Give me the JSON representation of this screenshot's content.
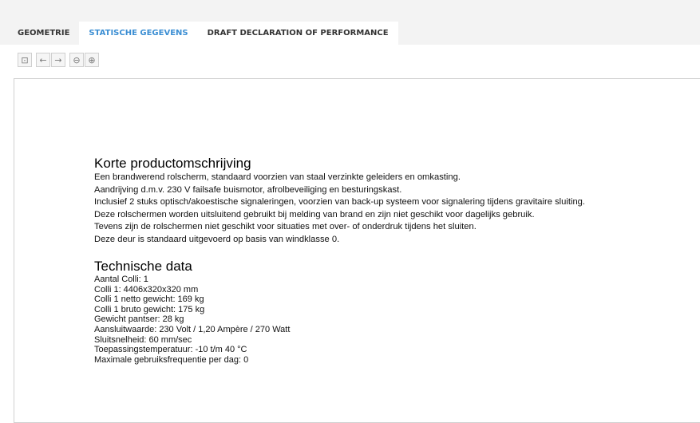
{
  "tabs": [
    {
      "label": "GEOMETRIE"
    },
    {
      "label": "STATISCHE GEGEVENS"
    },
    {
      "label": "DRAFT DECLARATION OF PERFORMANCE"
    }
  ],
  "toolbar": {
    "buttons": [
      {
        "name": "save-icon",
        "glyph": "⊡"
      },
      {
        "name": "back-arrow-icon",
        "glyph": "←"
      },
      {
        "name": "forward-arrow-icon",
        "glyph": "→"
      },
      {
        "name": "zoom-out-icon",
        "glyph": "⊖"
      },
      {
        "name": "zoom-in-icon",
        "glyph": "⊕"
      }
    ]
  },
  "document": {
    "description_title": "Korte productomschrijving",
    "description_lines": [
      "Een brandwerend rolscherm, standaard voorzien van staal verzinkte geleiders en omkasting.",
      "Aandrijving d.m.v. 230 V failsafe buismotor, afrolbeveiliging en besturingskast.",
      "Inclusief 2 stuks optisch/akoestische signaleringen, voorzien van back-up systeem voor signalering tijdens gravitaire sluiting.",
      "Deze rolschermen worden uitsluitend gebruikt bij melding van brand en zijn niet geschikt voor dagelijks gebruik.",
      "Tevens zijn de rolschermen niet geschikt voor situaties met over- of onderdruk tijdens het sluiten.",
      "Deze deur is standaard uitgevoerd op basis van windklasse 0."
    ],
    "tech_title": "Technische data",
    "tech_lines": [
      "Aantal Colli: 1",
      "Colli 1: 4406x320x320 mm",
      "Colli 1 netto gewicht: 169 kg",
      "Colli 1 bruto gewicht: 175 kg",
      "Gewicht pantser: 28 kg",
      "Aansluitwaarde: 230 Volt / 1,20 Ampère / 270 Watt",
      "Sluitsnelheid: 60 mm/sec",
      "Toepassingstemperatuur: -10 t/m 40 °C",
      "Maximale gebruiksfrequentie per dag: 0"
    ]
  }
}
